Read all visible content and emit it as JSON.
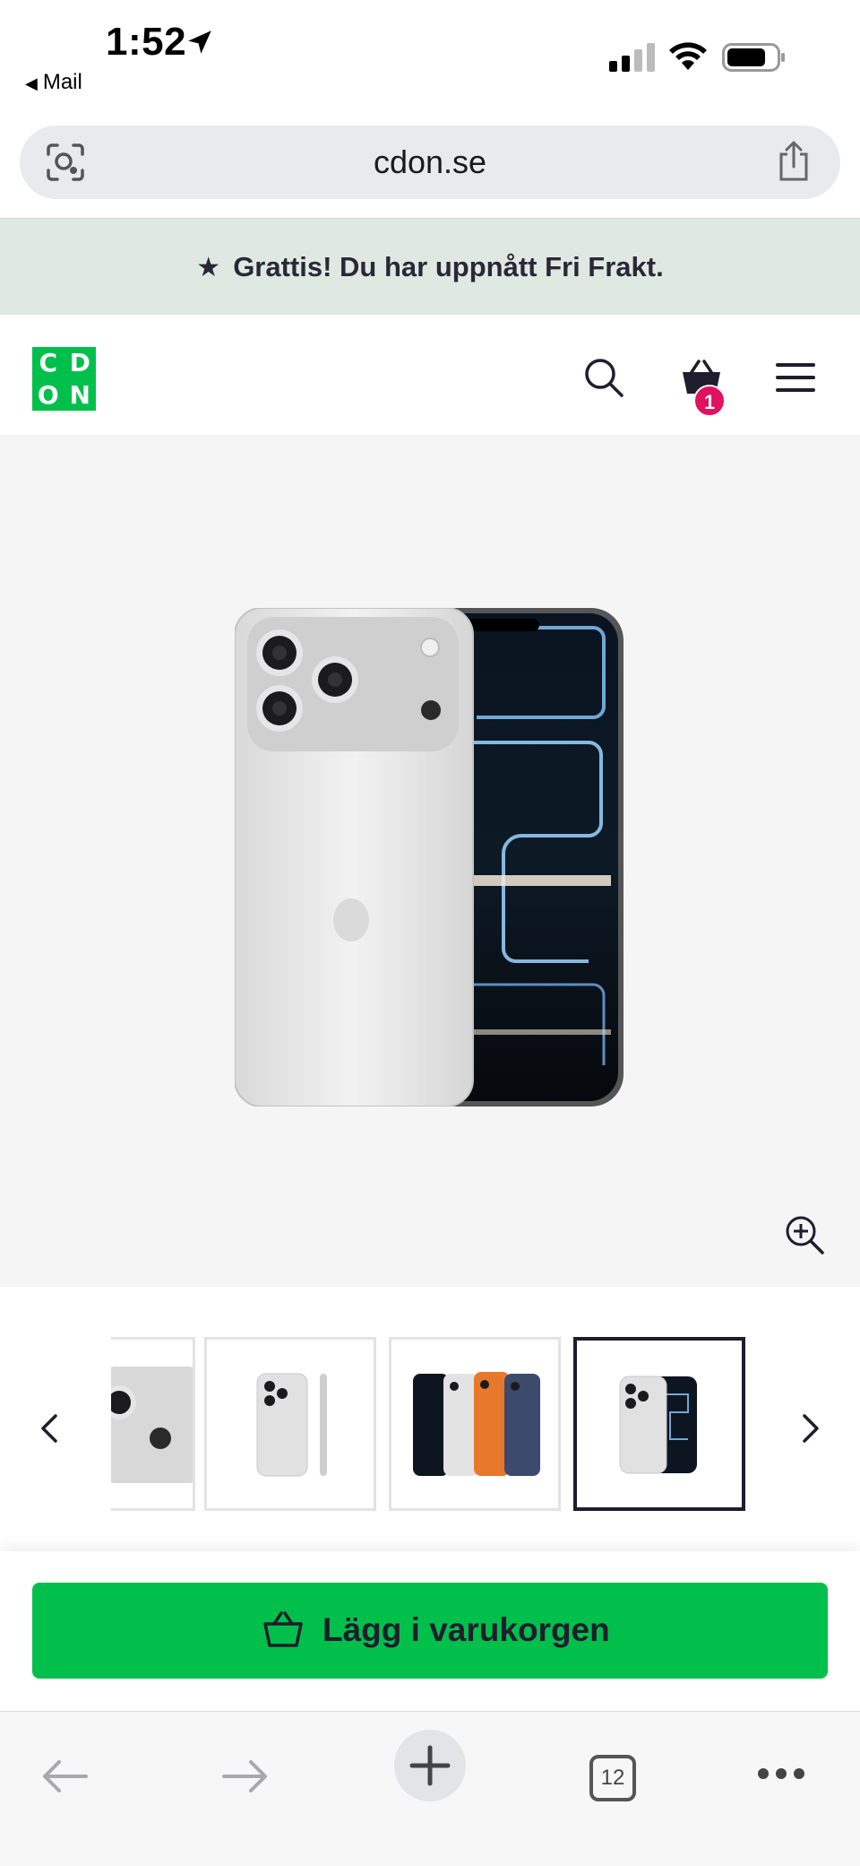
{
  "status_bar": {
    "time": "1:52",
    "back_app": "Mail"
  },
  "url_bar": {
    "url": "cdon.se"
  },
  "promo": {
    "text": "Grattis! Du har uppnått Fri Frakt."
  },
  "header": {
    "logo_letters": [
      "C",
      "D",
      "O",
      "N"
    ],
    "cart_count": "1"
  },
  "colors": {
    "brand_green": "#00c04b",
    "badge": "#e0115f",
    "promo_bg": "#dfe9e1",
    "text_dark": "#1f1d2e"
  },
  "gallery": {
    "selected_index": 3,
    "thumbnails": [
      "phone-back-closeup",
      "phone-back-and-side",
      "phones-four-colors",
      "phone-back-and-front"
    ]
  },
  "cart": {
    "add_label": "Lägg i varukorgen"
  },
  "toolbar": {
    "tab_count": "12"
  }
}
